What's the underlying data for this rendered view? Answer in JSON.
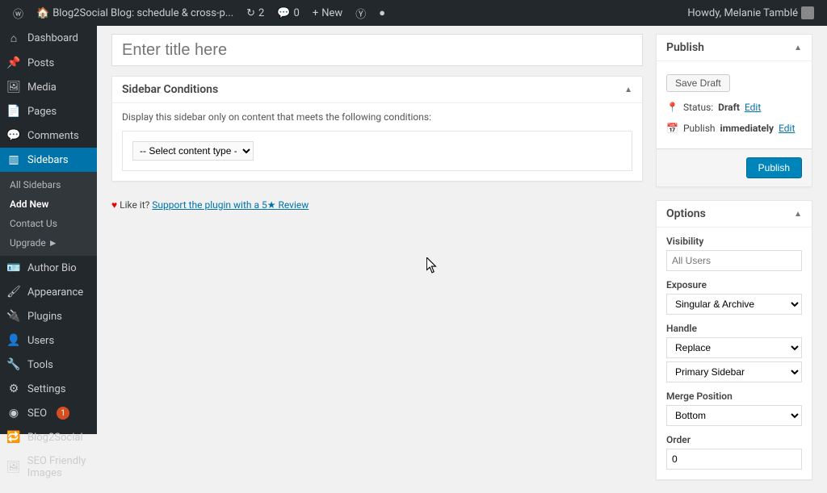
{
  "adminbar": {
    "site_name": "Blog2Social Blog: schedule & cross-p...",
    "updates": "2",
    "comments": "0",
    "new": "New",
    "greeting": "Howdy, Melanie Tamblé"
  },
  "menu": {
    "dashboard": "Dashboard",
    "posts": "Posts",
    "media": "Media",
    "pages": "Pages",
    "comments": "Comments",
    "sidebars": "Sidebars",
    "author_bio": "Author Bio",
    "appearance": "Appearance",
    "plugins": "Plugins",
    "users": "Users",
    "tools": "Tools",
    "settings": "Settings",
    "seo": "SEO",
    "seo_badge": "1",
    "blog2social": "Blog2Social",
    "seo_images": "SEO Friendly Images",
    "submenu": {
      "all": "All Sidebars",
      "add_new": "Add New",
      "contact": "Contact Us",
      "upgrade": "Upgrade ►"
    }
  },
  "editor": {
    "title_placeholder": "Enter title here",
    "panel_title": "Sidebar Conditions",
    "condition_intro": "Display this sidebar only on content that meets the following conditions:",
    "select_placeholder": "-- Select content type --",
    "like_it": "Like it?",
    "review_link": "Support the plugin with a 5★ Review"
  },
  "publish": {
    "title": "Publish",
    "save_draft": "Save Draft",
    "status_label": "Status:",
    "status_value": "Draft",
    "status_edit": "Edit",
    "when_label": "Publish",
    "when_value": "immediately",
    "when_edit": "Edit",
    "button": "Publish"
  },
  "options": {
    "title": "Options",
    "visibility_label": "Visibility",
    "visibility_value": "All Users",
    "exposure_label": "Exposure",
    "exposure_value": "Singular & Archive",
    "handle_label": "Handle",
    "handle_action": "Replace",
    "handle_target": "Primary Sidebar",
    "merge_label": "Merge Position",
    "merge_value": "Bottom",
    "order_label": "Order",
    "order_value": "0"
  }
}
